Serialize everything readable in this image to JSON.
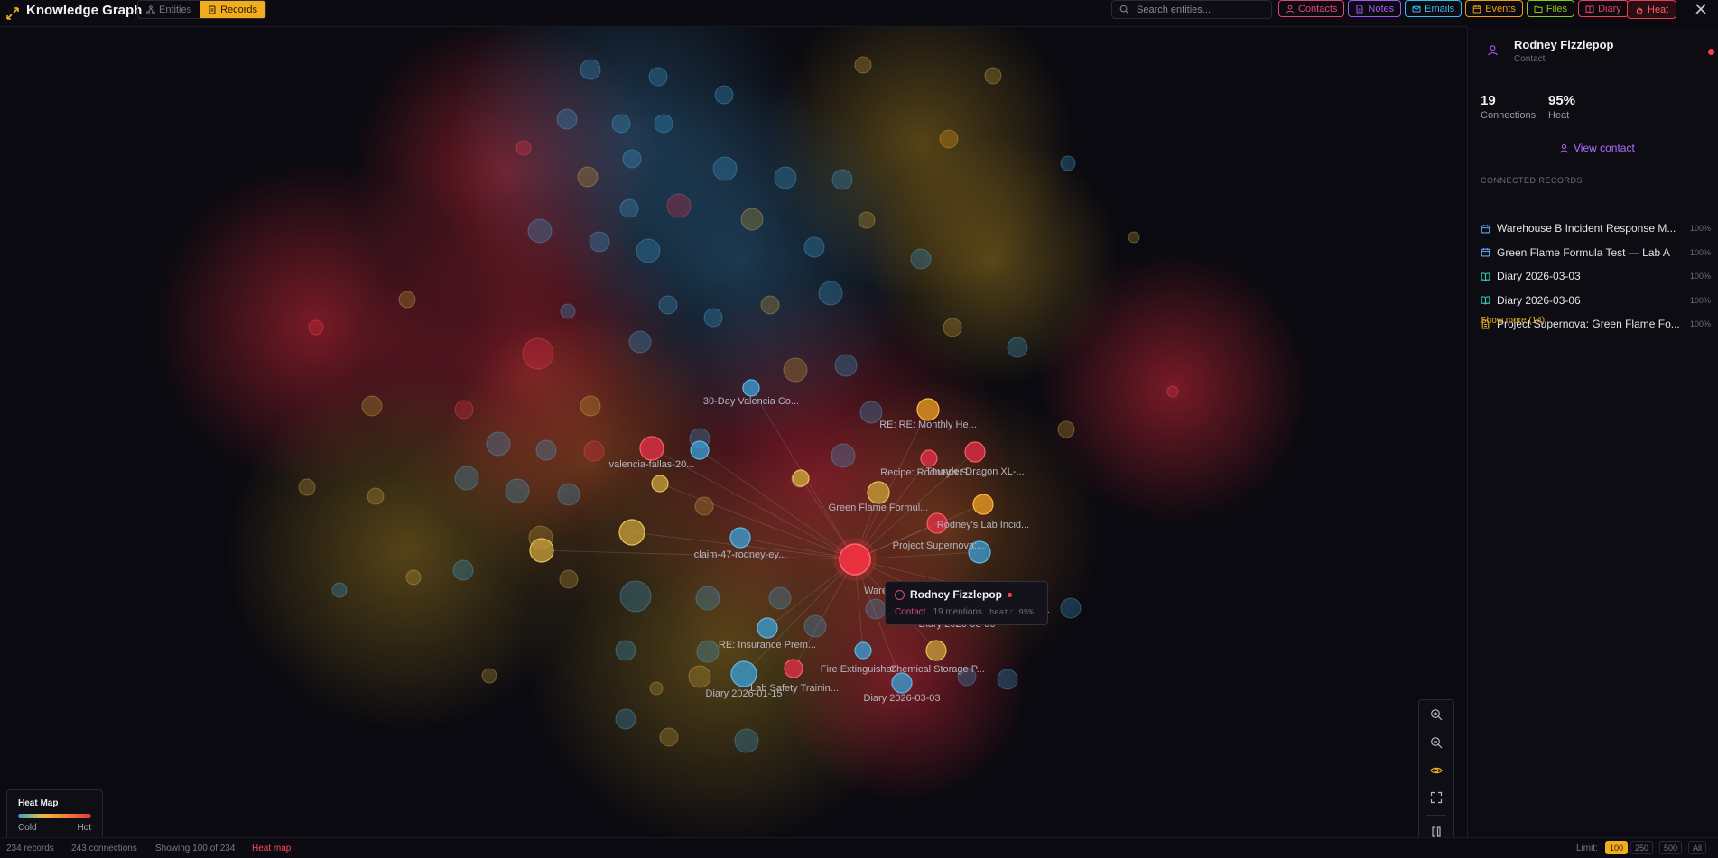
{
  "app": {
    "title": "Knowledge Graph"
  },
  "view_toggle": {
    "entities": "Entities",
    "records": "Records",
    "active": "records"
  },
  "search": {
    "placeholder": "Search entities...",
    "value": ""
  },
  "filters": [
    {
      "label": "Contacts",
      "color": "#e0457a",
      "icon": "user-icon"
    },
    {
      "label": "Notes",
      "color": "#a855f7",
      "icon": "note-icon"
    },
    {
      "label": "Emails",
      "color": "#38bdf8",
      "icon": "mail-icon"
    },
    {
      "label": "Events",
      "color": "#f59e0b",
      "icon": "calendar-icon"
    },
    {
      "label": "Files",
      "color": "#84cc16",
      "icon": "folder-icon"
    },
    {
      "label": "Diary",
      "color": "#f43f5e",
      "icon": "book-icon"
    }
  ],
  "heat_button": {
    "label": "Heat"
  },
  "graph": {
    "labels": [
      "30-Day Valencia Co...",
      "RE: RE: Monthly He...",
      "valencia-fallas-20...",
      "Recipe: Rodney's S...",
      "Thunder Dragon XL-...",
      "Green Flame Formul...",
      "Rodney's Lab Incid...",
      "Project Supernova:...",
      "claim-47-rodney-ey...",
      "Ware",
      "Warehouse B Ventil...",
      "Diary 2026-03-06",
      "RE: Insurance Prem...",
      "Fire Extinguisher",
      "Chemical Storage P...",
      "Lab Safety Trainin...",
      "Diary 2026-01-15",
      "Diary 2026-03-03"
    ]
  },
  "tooltip": {
    "name": "Rodney Fizzlepop",
    "type": "Contact",
    "mentions": "19 mentions",
    "heat": "heat: 95%"
  },
  "legend": {
    "title": "Heat Map",
    "cold": "Cold",
    "hot": "Hot"
  },
  "status": {
    "records": "234 records",
    "connections": "243 connections",
    "showing": "Showing 100 of 234",
    "mode": "Heat map",
    "limit_label": "Limit:",
    "limits": [
      "100",
      "250",
      "500",
      "All"
    ],
    "limit_active": "100"
  },
  "panel": {
    "name": "Rodney Fizzlepop",
    "type": "Contact",
    "connections_value": "19",
    "connections_label": "Connections",
    "heat_value": "95%",
    "heat_label": "Heat",
    "view_contact": "View contact",
    "section_title": "CONNECTED RECORDS",
    "records": [
      {
        "title": "Warehouse B Incident Response M...",
        "pct": "100%",
        "icon": "calendar-icon",
        "color": "#60a5fa"
      },
      {
        "title": "Green Flame Formula Test — Lab A",
        "pct": "100%",
        "icon": "calendar-icon",
        "color": "#60a5fa"
      },
      {
        "title": "Diary 2026-03-03",
        "pct": "100%",
        "icon": "book-icon",
        "color": "#2dd4bf"
      },
      {
        "title": "Diary 2026-03-06",
        "pct": "100%",
        "icon": "book-icon",
        "color": "#2dd4bf"
      },
      {
        "title": "Project Supernova: Green Flame Fo...",
        "pct": "100%",
        "icon": "note-icon",
        "color": "#f0ae1f"
      }
    ],
    "show_more": "Show more (14)"
  }
}
